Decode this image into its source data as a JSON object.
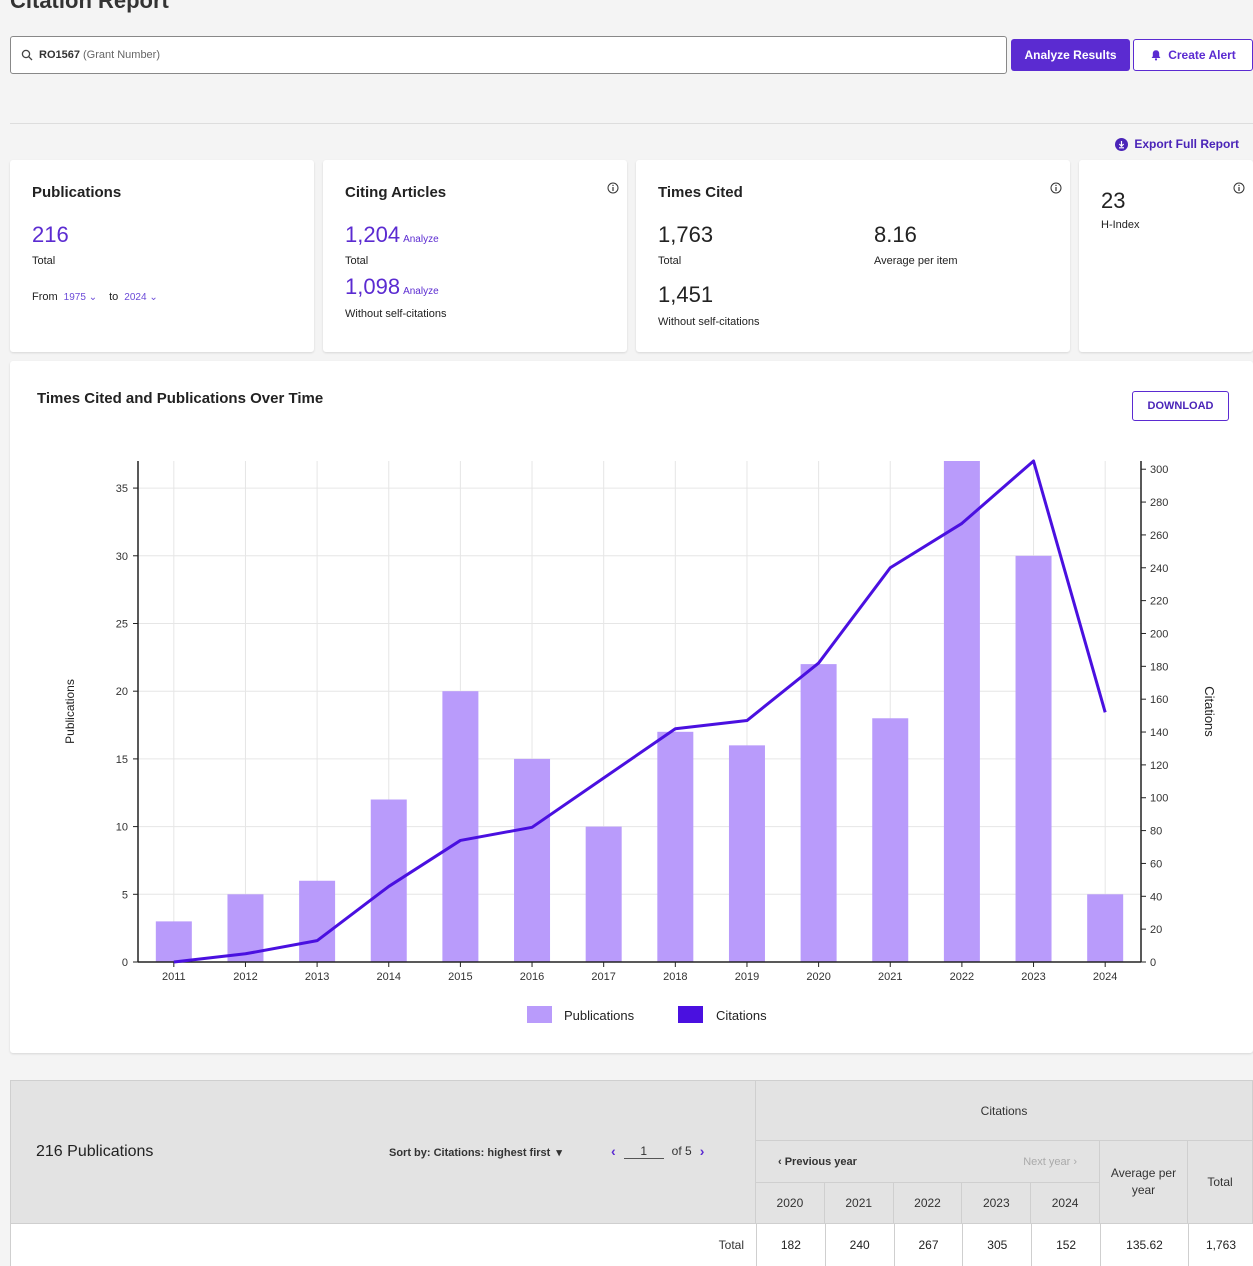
{
  "colors": {
    "accent": "#5b2bd1",
    "bar": "#b99bfb",
    "line": "#4a10e0"
  },
  "page_title_partial": "Citation Report",
  "search": {
    "value": "RO1567",
    "field": "(Grant Number)"
  },
  "buttons": {
    "analyze": "Analyze Results",
    "alert": "Create Alert",
    "export": "Export Full Report",
    "download": "DOWNLOAD"
  },
  "cards": {
    "publications": {
      "title": "Publications",
      "total": "216",
      "total_label": "Total",
      "from_label": "From",
      "from_year": "1975",
      "to_label": "to",
      "to_year": "2024"
    },
    "citing": {
      "title": "Citing Articles",
      "total": "1,204",
      "analyze": "Analyze",
      "total_label": "Total",
      "without": "1,098",
      "without_label": "Without self-citations"
    },
    "times_cited": {
      "title": "Times Cited",
      "total": "1,763",
      "total_label": "Total",
      "avg": "8.16",
      "avg_label": "Average per item",
      "without": "1,451",
      "without_label": "Without self-citations"
    },
    "hindex": {
      "value": "23",
      "label": "H-Index"
    }
  },
  "chart_title": "Times Cited and Publications Over Time",
  "chart_data": {
    "type": "bar",
    "categories": [
      "2011",
      "2012",
      "2013",
      "2014",
      "2015",
      "2016",
      "2017",
      "2018",
      "2019",
      "2020",
      "2021",
      "2022",
      "2023",
      "2024"
    ],
    "series": [
      {
        "name": "Publications",
        "type": "bar",
        "axis": "left",
        "values": [
          3,
          5,
          6,
          12,
          20,
          15,
          10,
          17,
          16,
          22,
          18,
          37,
          30,
          5
        ]
      },
      {
        "name": "Citations",
        "type": "line",
        "axis": "right",
        "values": [
          0,
          5,
          13,
          46,
          74,
          82,
          112,
          142,
          147,
          182,
          240,
          267,
          305,
          152
        ]
      }
    ],
    "ylabel": "Publications",
    "y2label": "Citations",
    "ylim": [
      0,
      37
    ],
    "y2lim": [
      0,
      305
    ],
    "yticks": [
      0,
      5,
      10,
      15,
      20,
      25,
      30,
      35
    ],
    "y2ticks": [
      0,
      20,
      40,
      60,
      80,
      100,
      120,
      140,
      160,
      180,
      200,
      220,
      240,
      260,
      280,
      300
    ],
    "grid": true,
    "legend": "bottom"
  },
  "table": {
    "count_label": "216 Publications",
    "sort_label": "Sort by: Citations: highest first",
    "page": "1",
    "of_label": "of 5",
    "citations_header": "Citations",
    "prev_year": "‹ Previous year",
    "next_year": "Next year ›",
    "avg_header": "Average per year",
    "total_header": "Total",
    "years": [
      "2020",
      "2021",
      "2022",
      "2023",
      "2024"
    ],
    "total_row": {
      "label": "Total",
      "values": [
        "182",
        "240",
        "267",
        "305",
        "152"
      ],
      "avg": "135.62",
      "total": "1,763"
    }
  }
}
